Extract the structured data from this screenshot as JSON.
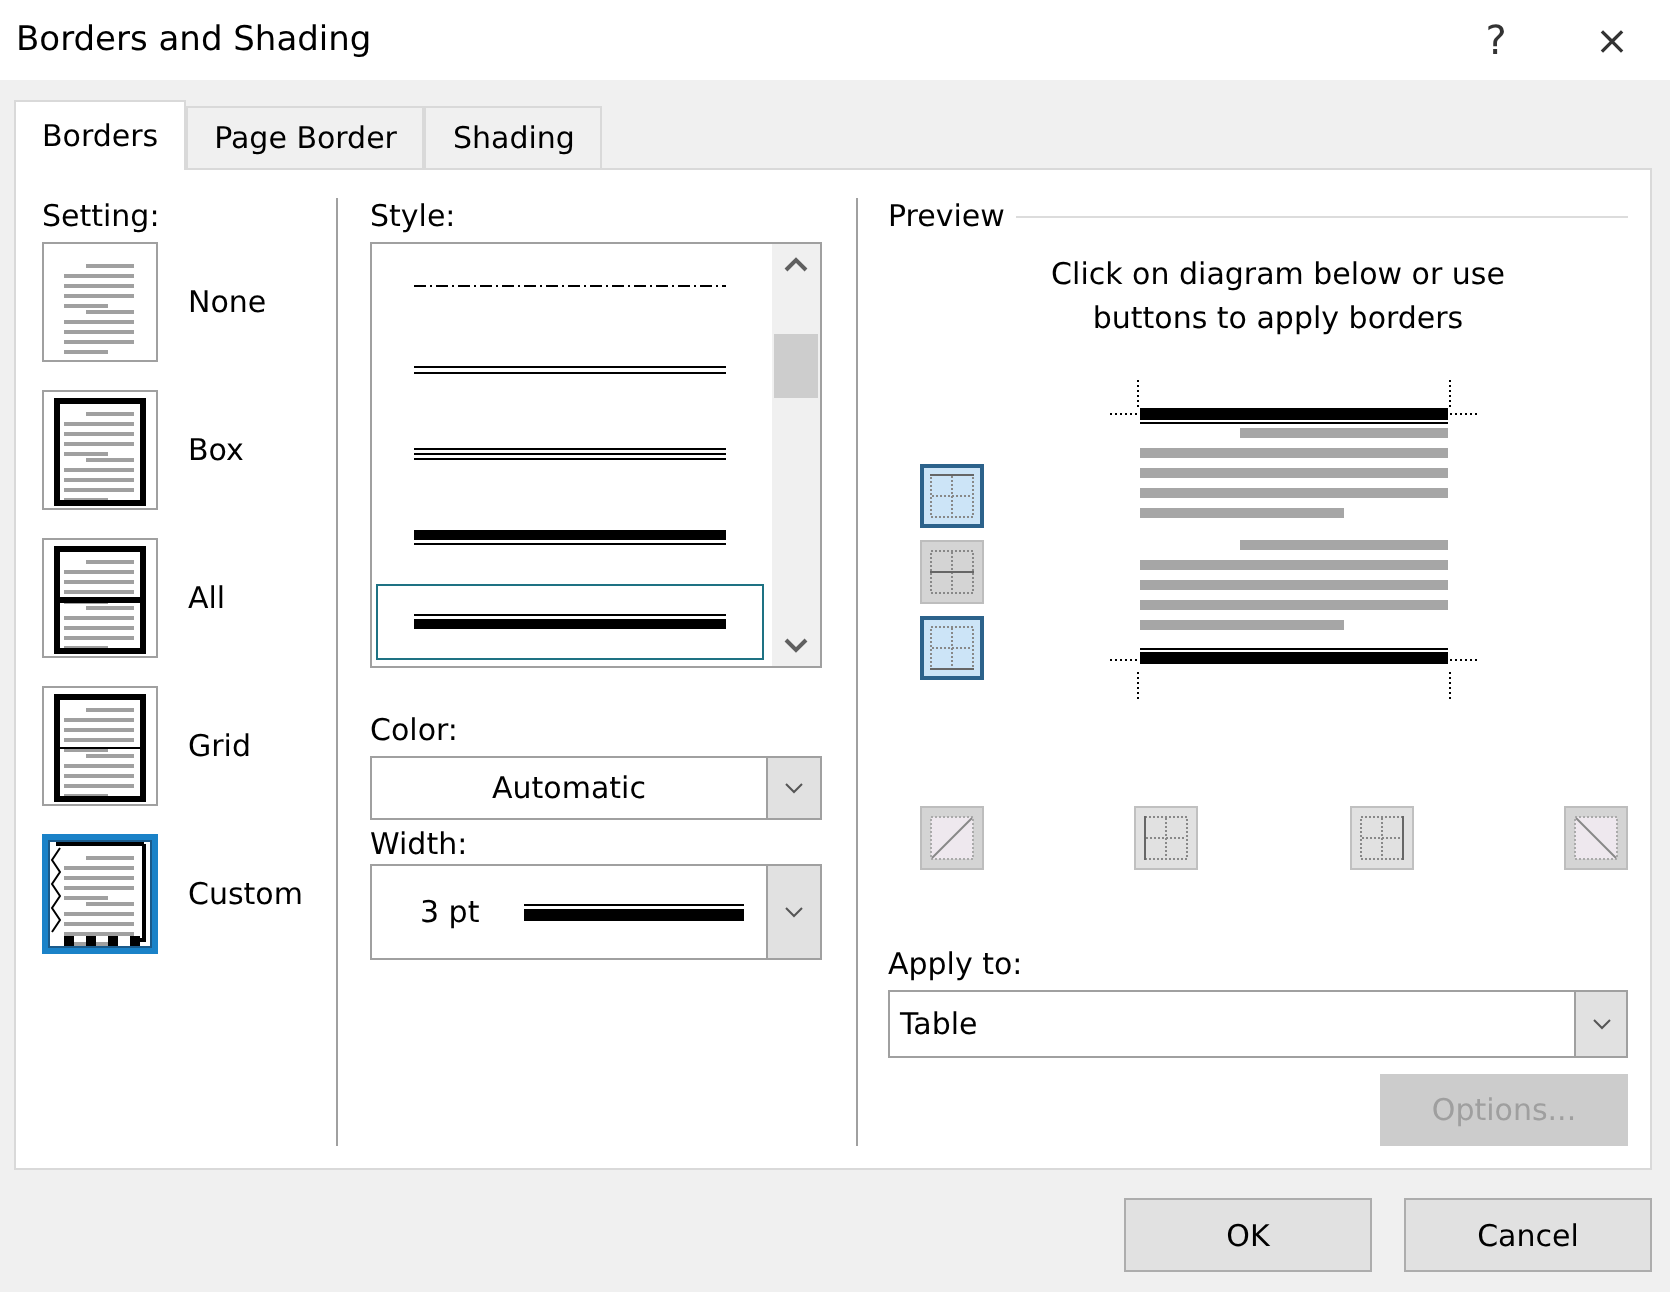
{
  "window": {
    "title": "Borders and Shading",
    "help": "?",
    "close": "×"
  },
  "tabs": [
    {
      "label": "Borders",
      "selected": true
    },
    {
      "label": "Page Border",
      "selected": false
    },
    {
      "label": "Shading",
      "selected": false
    }
  ],
  "setting": {
    "label": "Setting:",
    "options": [
      {
        "kind": "none",
        "label": "None",
        "selected": false
      },
      {
        "kind": "box",
        "label": "Box",
        "selected": false
      },
      {
        "kind": "all",
        "label": "All",
        "selected": false
      },
      {
        "kind": "grid",
        "label": "Grid",
        "selected": false
      },
      {
        "kind": "custom",
        "label": "Custom",
        "selected": true
      }
    ]
  },
  "style": {
    "label": "Style:",
    "options": [
      {
        "kind": "dash-dot",
        "selected": false
      },
      {
        "kind": "double",
        "selected": false
      },
      {
        "kind": "triple",
        "selected": false
      },
      {
        "kind": "thick-thin",
        "selected": false
      },
      {
        "kind": "thin-thick",
        "selected": true
      }
    ]
  },
  "color": {
    "label": "Color:",
    "value": "Automatic"
  },
  "width": {
    "label": "Width:",
    "value": "3 pt"
  },
  "preview": {
    "label": "Preview",
    "hint": "Click on diagram below or use buttons to apply borders",
    "side_buttons": [
      {
        "kind": "top",
        "pressed": true,
        "disabled": false
      },
      {
        "kind": "inside-h",
        "pressed": false,
        "disabled": true
      },
      {
        "kind": "bottom",
        "pressed": true,
        "disabled": false
      }
    ],
    "bottom_buttons": [
      {
        "kind": "diag-up",
        "pressed": false,
        "disabled": true
      },
      {
        "kind": "left",
        "pressed": false,
        "disabled": false
      },
      {
        "kind": "right",
        "pressed": false,
        "disabled": false
      },
      {
        "kind": "diag-down",
        "pressed": false,
        "disabled": true
      }
    ]
  },
  "apply_to": {
    "label": "Apply to:",
    "value": "Table"
  },
  "options_button": {
    "label": "Options...",
    "disabled": true
  },
  "buttons": [
    "OK",
    "Cancel"
  ]
}
